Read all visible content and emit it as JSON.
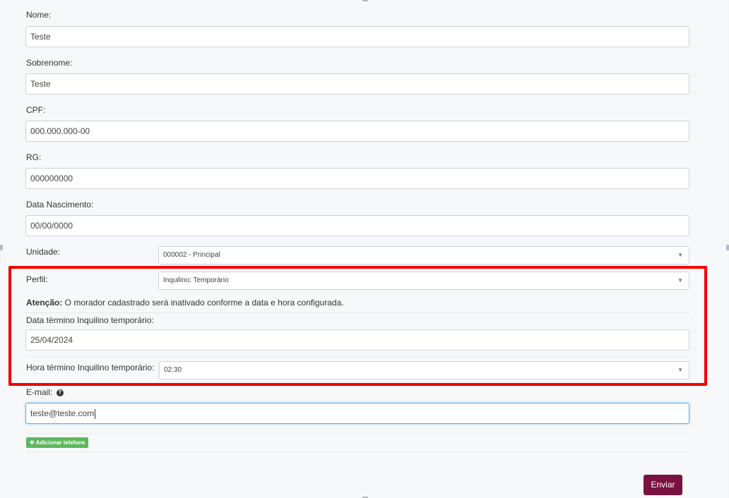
{
  "form": {
    "nome": {
      "label": "Nome:",
      "value": "Teste"
    },
    "sobrenome": {
      "label": "Sobrenome:",
      "value": "Teste"
    },
    "cpf": {
      "label": "CPF:",
      "value": "000.000.000-00"
    },
    "rg": {
      "label": "RG:",
      "value": "000000000"
    },
    "nascimento": {
      "label": "Data Nascimento:",
      "value": "00/00/0000"
    },
    "unidade": {
      "label": "Unidade:",
      "value": "000002 - Principal"
    },
    "perfil": {
      "label": "Perfil:",
      "value": "Inquilino: Temporário"
    },
    "notice": {
      "strong": "Atenção:",
      "text": " O morador cadastrado será inativado conforme a data e hora configurada."
    },
    "data_termino": {
      "label": "Data término Inquilino temporário:",
      "value": "25/04/2024"
    },
    "hora_termino": {
      "label": "Hora término Inquilino temporário:",
      "value": "02:30"
    },
    "email": {
      "label": "E-mail:",
      "value": "teste@teste.com",
      "help_icon": "question-circle-icon"
    },
    "add_phone_label": "Adicionar telefone",
    "add_phone_icon": "plus-icon",
    "submit_label": "Enviar"
  },
  "colors": {
    "highlight": "#ee0000",
    "submit": "#7a1140",
    "add_phone": "#5cb85c",
    "focus_border": "#66afe9"
  }
}
